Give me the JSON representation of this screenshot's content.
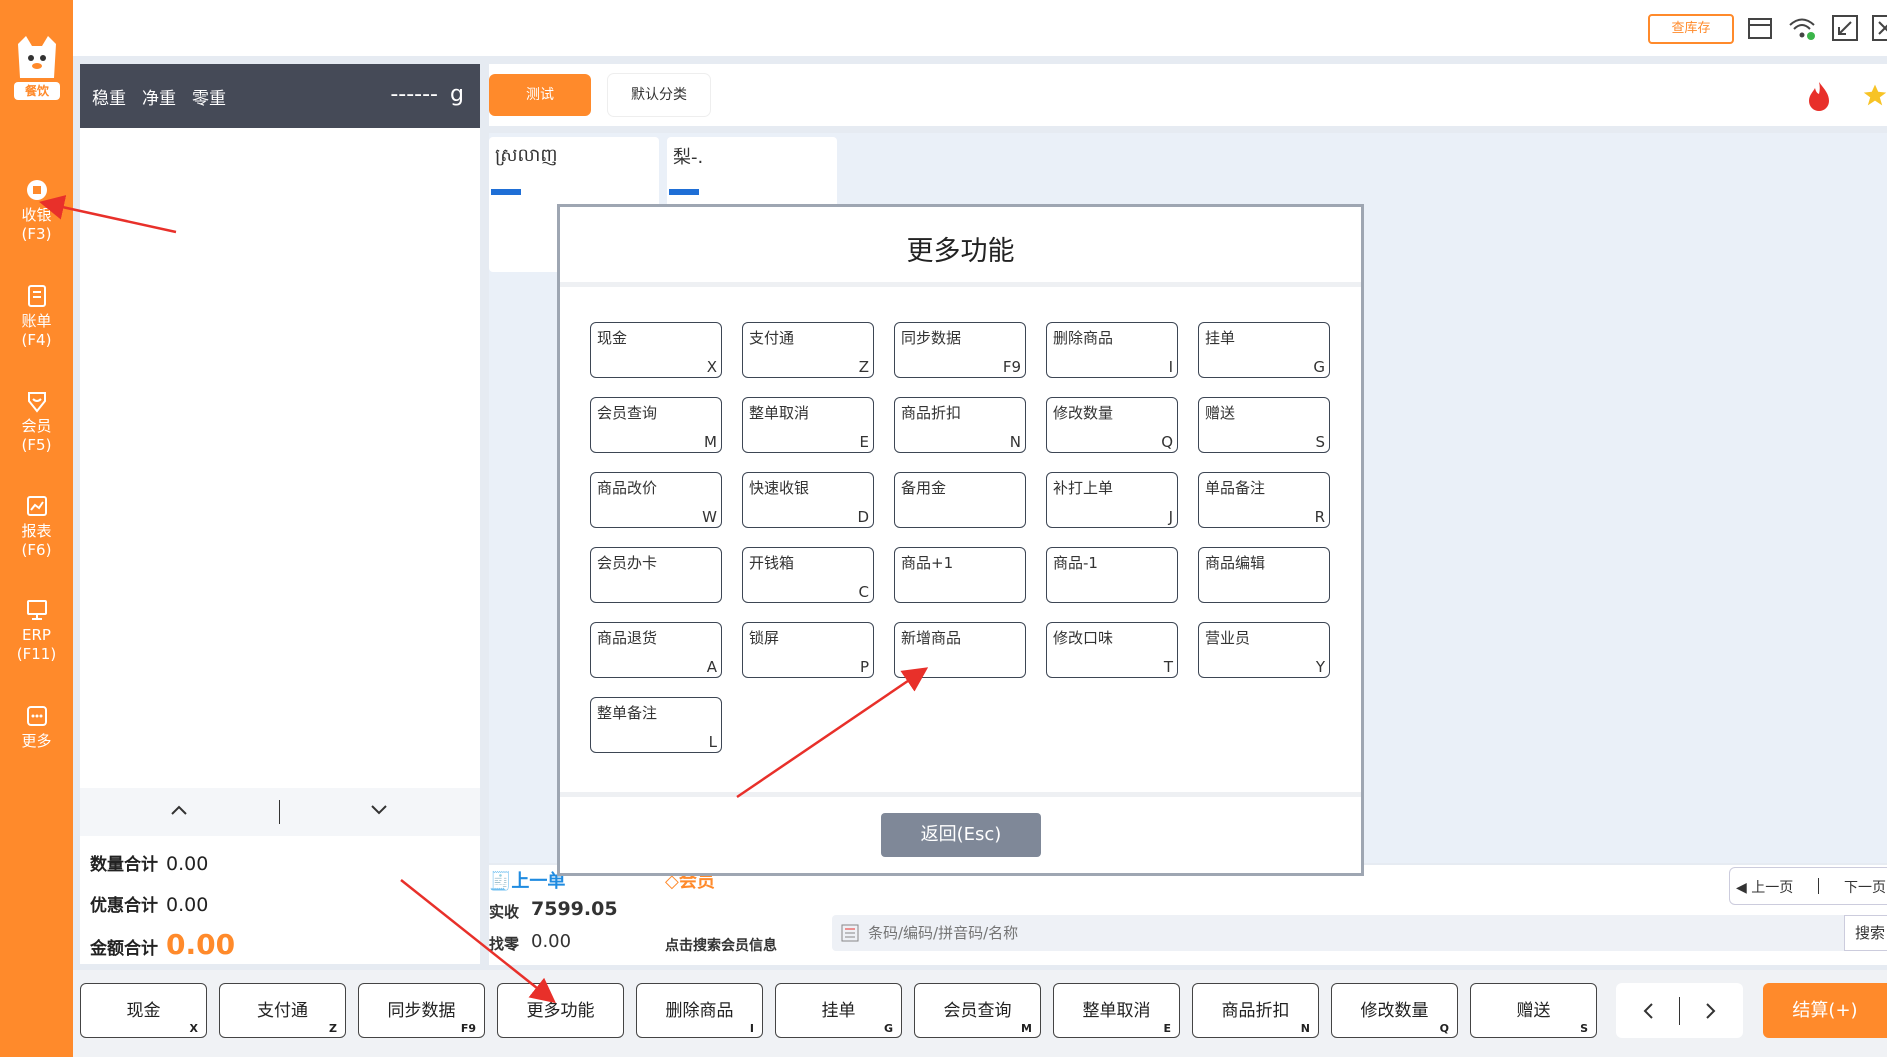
{
  "sidebar": {
    "logo_text": "餐饮",
    "items": [
      {
        "label": "收银",
        "key": "(F3)"
      },
      {
        "label": "账单",
        "key": "(F4)"
      },
      {
        "label": "会员",
        "key": "(F5)"
      },
      {
        "label": "报表",
        "key": "(F6)"
      },
      {
        "label": "ERP",
        "key": "(F11)"
      },
      {
        "label": "更多",
        "key": ""
      }
    ]
  },
  "topbar": {
    "stock_button": "查库存"
  },
  "scale": {
    "stable": "稳重",
    "net": "净重",
    "zero": "零重",
    "value": "------",
    "unit": "g"
  },
  "totals": {
    "qty_label": "数量合计",
    "qty_value": "0.00",
    "discount_label": "优惠合计",
    "discount_value": "0.00",
    "amount_label": "金额合计",
    "amount_value": "0.00"
  },
  "categories": {
    "active": "测试",
    "default": "默认分类"
  },
  "products": [
    {
      "name": "ស្រលាញ"
    },
    {
      "name": "梨-."
    }
  ],
  "info": {
    "last_order": "上一单",
    "member": "会员",
    "received_label": "实收",
    "received_value": "7599.05",
    "change_label": "找零",
    "change_value": "0.00",
    "search_member": "点击搜索会员信息",
    "search_placeholder": "条码/编码/拼音码/名称",
    "search_button": "搜索",
    "prev_page": "上一页",
    "next_page": "下一页"
  },
  "function_bar": [
    {
      "label": "现金",
      "key": "X"
    },
    {
      "label": "支付通",
      "key": "Z"
    },
    {
      "label": "同步数据",
      "key": "F9"
    },
    {
      "label": "更多功能",
      "key": ""
    },
    {
      "label": "删除商品",
      "key": "I"
    },
    {
      "label": "挂单",
      "key": "G"
    },
    {
      "label": "会员查询",
      "key": "M"
    },
    {
      "label": "整单取消",
      "key": "E"
    },
    {
      "label": "商品折扣",
      "key": "N"
    },
    {
      "label": "修改数量",
      "key": "Q"
    },
    {
      "label": "赠送",
      "key": "S"
    }
  ],
  "checkout_label": "结算(+)",
  "modal": {
    "title": "更多功能",
    "back_label": "返回(Esc)",
    "buttons": [
      {
        "label": "现金",
        "key": "X"
      },
      {
        "label": "支付通",
        "key": "Z"
      },
      {
        "label": "同步数据",
        "key": "F9"
      },
      {
        "label": "删除商品",
        "key": "I"
      },
      {
        "label": "挂单",
        "key": "G"
      },
      {
        "label": "会员查询",
        "key": "M"
      },
      {
        "label": "整单取消",
        "key": "E"
      },
      {
        "label": "商品折扣",
        "key": "N"
      },
      {
        "label": "修改数量",
        "key": "Q"
      },
      {
        "label": "赠送",
        "key": "S"
      },
      {
        "label": "商品改价",
        "key": "W"
      },
      {
        "label": "快速收银",
        "key": "D"
      },
      {
        "label": "备用金",
        "key": ""
      },
      {
        "label": "补打上单",
        "key": "J"
      },
      {
        "label": "单品备注",
        "key": "R"
      },
      {
        "label": "会员办卡",
        "key": ""
      },
      {
        "label": "开钱箱",
        "key": "C"
      },
      {
        "label": "商品+1",
        "key": ""
      },
      {
        "label": "商品-1",
        "key": ""
      },
      {
        "label": "商品编辑",
        "key": ""
      },
      {
        "label": "商品退货",
        "key": "A"
      },
      {
        "label": "锁屏",
        "key": "P"
      },
      {
        "label": "新增商品",
        "key": ""
      },
      {
        "label": "修改口味",
        "key": "T"
      },
      {
        "label": "营业员",
        "key": "Y"
      },
      {
        "label": "整单备注",
        "key": "L"
      }
    ]
  },
  "colors": {
    "accent": "#ff8a2b",
    "dark": "#454a57",
    "arrow": "#e8302a",
    "back_button": "#7f8898"
  }
}
